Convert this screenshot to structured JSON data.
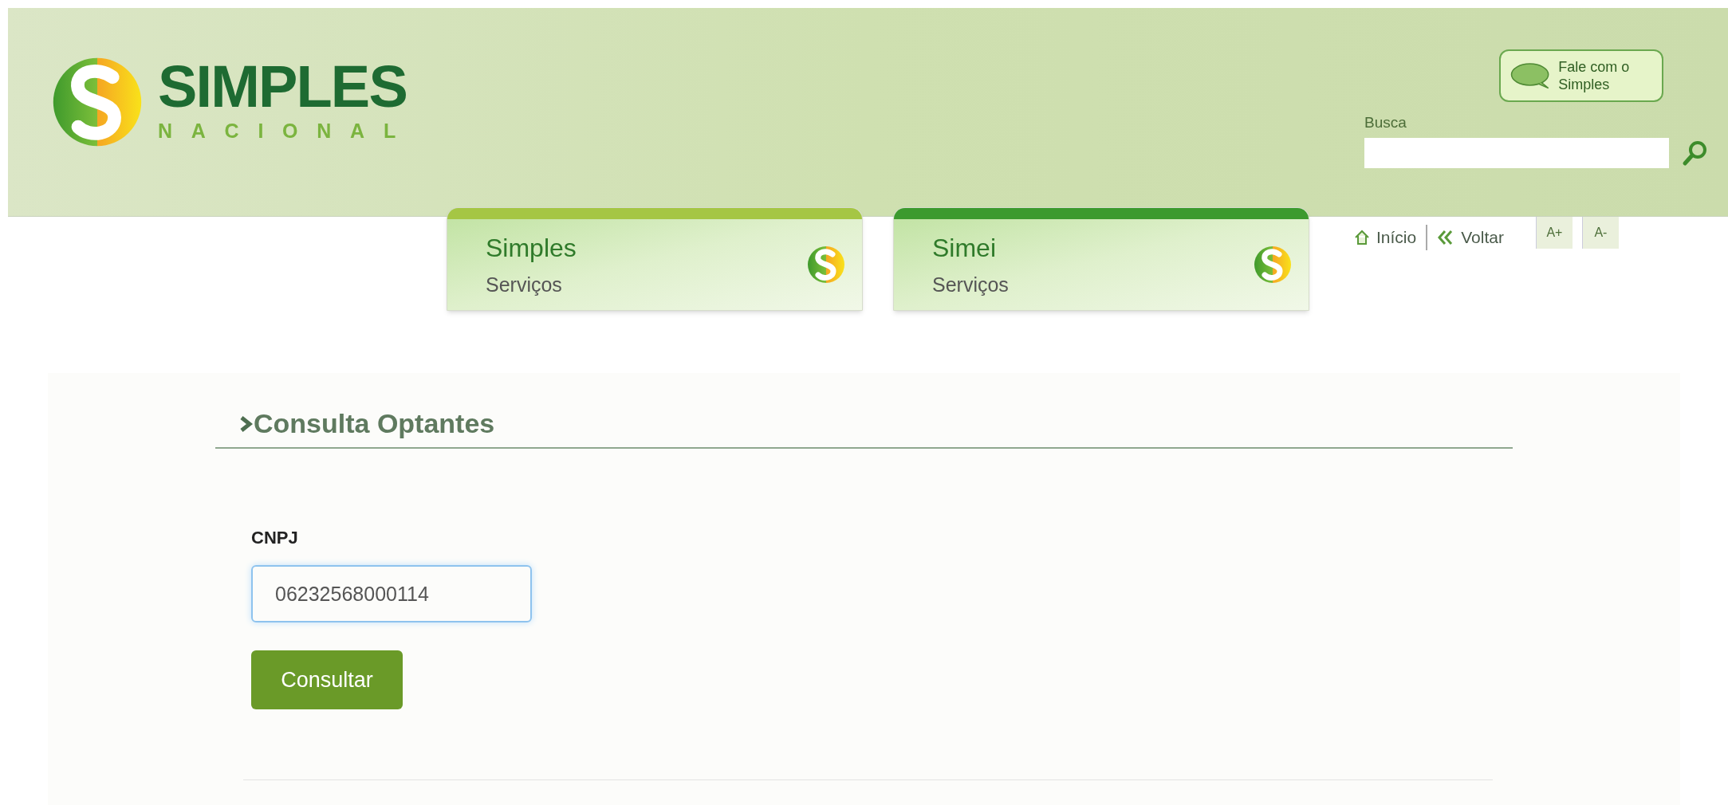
{
  "logo": {
    "title": "SIMPLES",
    "subtitle": "NACIONAL"
  },
  "contact_button": {
    "label": "Fale com o Simples"
  },
  "search": {
    "label": "Busca"
  },
  "service_tabs": [
    {
      "title": "Simples",
      "subtitle": "Serviços",
      "color": "#a5c644"
    },
    {
      "title": "Simei",
      "subtitle": "Serviços",
      "color": "#3c9a2e"
    }
  ],
  "nav_links": [
    {
      "kind": "home",
      "label": "Início"
    },
    {
      "kind": "back",
      "label": "Voltar"
    }
  ],
  "font_buttons": [
    "A+",
    "A-"
  ],
  "form": {
    "heading": "Consulta Optantes",
    "field_label": "CNPJ",
    "field_value": "06232568000114",
    "submit": "Consultar"
  }
}
